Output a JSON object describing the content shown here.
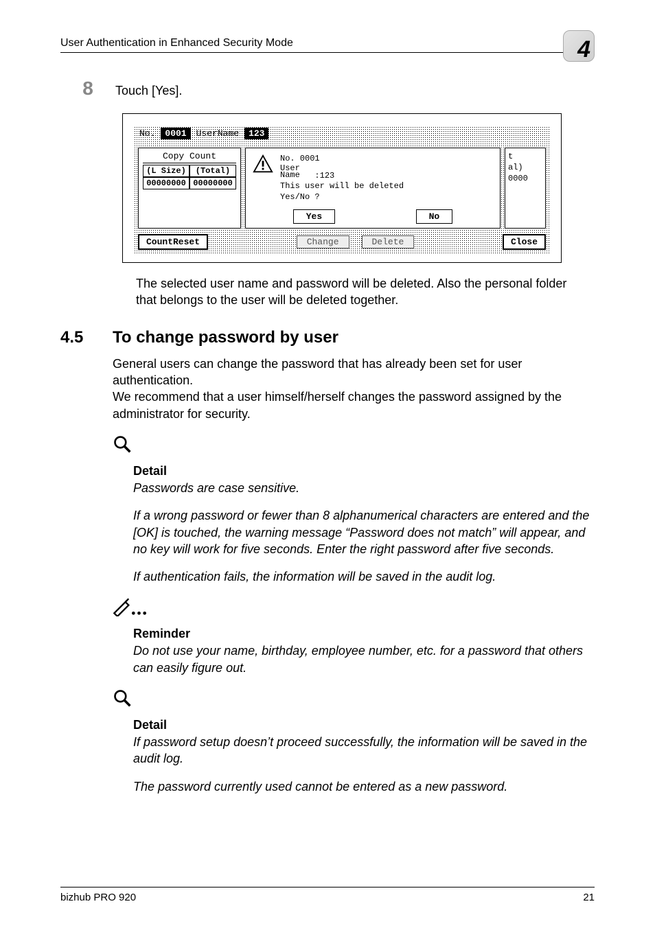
{
  "header": {
    "title": "User Authentication in Enhanced Security Mode",
    "chapter": "4"
  },
  "step": {
    "number": "8",
    "text": "Touch [Yes]."
  },
  "screenshot": {
    "top": {
      "no_label": "No.",
      "no_value": "0001",
      "user_label": "UserName",
      "user_value": "123"
    },
    "left_panel": {
      "title": "Copy Count",
      "col1_head": "(L Size)",
      "col2_head": "(Total)",
      "col1_val": "00000000",
      "col2_val": "00000000"
    },
    "modal": {
      "line1": "No. 0001",
      "line2a": "User",
      "line2b": "Name",
      "line2c": ":123",
      "line3": "This user will be deleted",
      "line4": "Yes/No ?",
      "yes": "Yes",
      "no": "No"
    },
    "right_panel": {
      "r1": "t",
      "r2": "al)",
      "r3": "0000"
    },
    "under": {
      "count_reset": "CountReset",
      "change": "Change",
      "delete": "Delete",
      "close": "Close"
    }
  },
  "after_screenshot": "The selected user name and password will be deleted. Also the personal folder that belongs to the user will be deleted together.",
  "section": {
    "number": "4.5",
    "title": "To change password by user",
    "intro1": "General users can change the password that has already been set for user authentication.",
    "intro2": "We recommend that a user himself/herself changes the password assigned by the administrator for security."
  },
  "detail1": {
    "title": "Detail",
    "p1": "Passwords are case sensitive.",
    "p2": "If a wrong password or fewer than 8 alphanumerical characters are entered and the [OK] is touched, the warning message “Password does not match” will appear, and no key will work for five seconds. Enter the right password after five seconds.",
    "p3": "If authentication fails, the information will be saved in the audit log."
  },
  "reminder": {
    "title": "Reminder",
    "p1": "Do not use your name, birthday, employee number, etc. for a password that others can easily figure out."
  },
  "detail2": {
    "title": "Detail",
    "p1": "If password setup doesn’t proceed successfully, the information will be saved in the audit log.",
    "p2": "The password currently used cannot be entered as a new password."
  },
  "footer": {
    "left": "bizhub PRO 920",
    "right": "21"
  }
}
